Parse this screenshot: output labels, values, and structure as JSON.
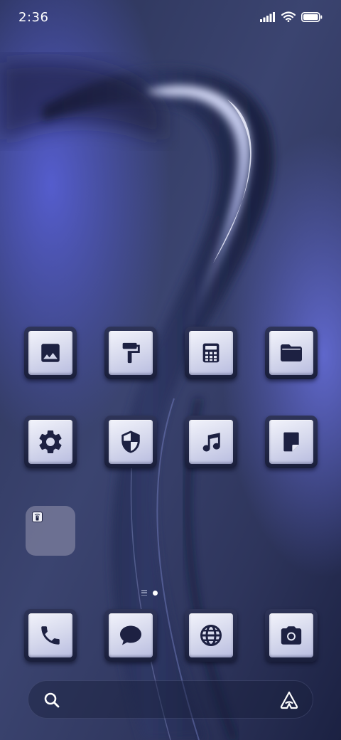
{
  "status_bar": {
    "time": "2:36",
    "icons": [
      "signal-icon",
      "wifi-icon",
      "battery-icon"
    ]
  },
  "home": {
    "apps": [
      {
        "name": "gallery",
        "icon": "image-icon"
      },
      {
        "name": "themes",
        "icon": "paint-roller-icon"
      },
      {
        "name": "calculator",
        "icon": "calculator-icon"
      },
      {
        "name": "file-manager",
        "icon": "folder-icon"
      },
      {
        "name": "settings",
        "icon": "gear-icon"
      },
      {
        "name": "security",
        "icon": "shield-icon"
      },
      {
        "name": "music",
        "icon": "music-note-icon"
      },
      {
        "name": "notes",
        "icon": "note-icon"
      }
    ],
    "widget": {
      "icon": "remote-control-icon"
    }
  },
  "page_indicator": {
    "pages": 1,
    "current": 1
  },
  "dock": {
    "apps": [
      {
        "name": "phone",
        "icon": "phone-icon"
      },
      {
        "name": "messages",
        "icon": "chat-bubble-icon"
      },
      {
        "name": "browser",
        "icon": "globe-icon"
      },
      {
        "name": "camera",
        "icon": "camera-icon"
      }
    ]
  },
  "search_bar": {
    "left_icon": "search-icon",
    "right_icon": "assistant-icon"
  },
  "colors": {
    "icon_glyph": "#1d2142",
    "icon_face": "#e6e8f5",
    "wallpaper_base": "#242c52",
    "accent_glow": "#5d66d8"
  }
}
